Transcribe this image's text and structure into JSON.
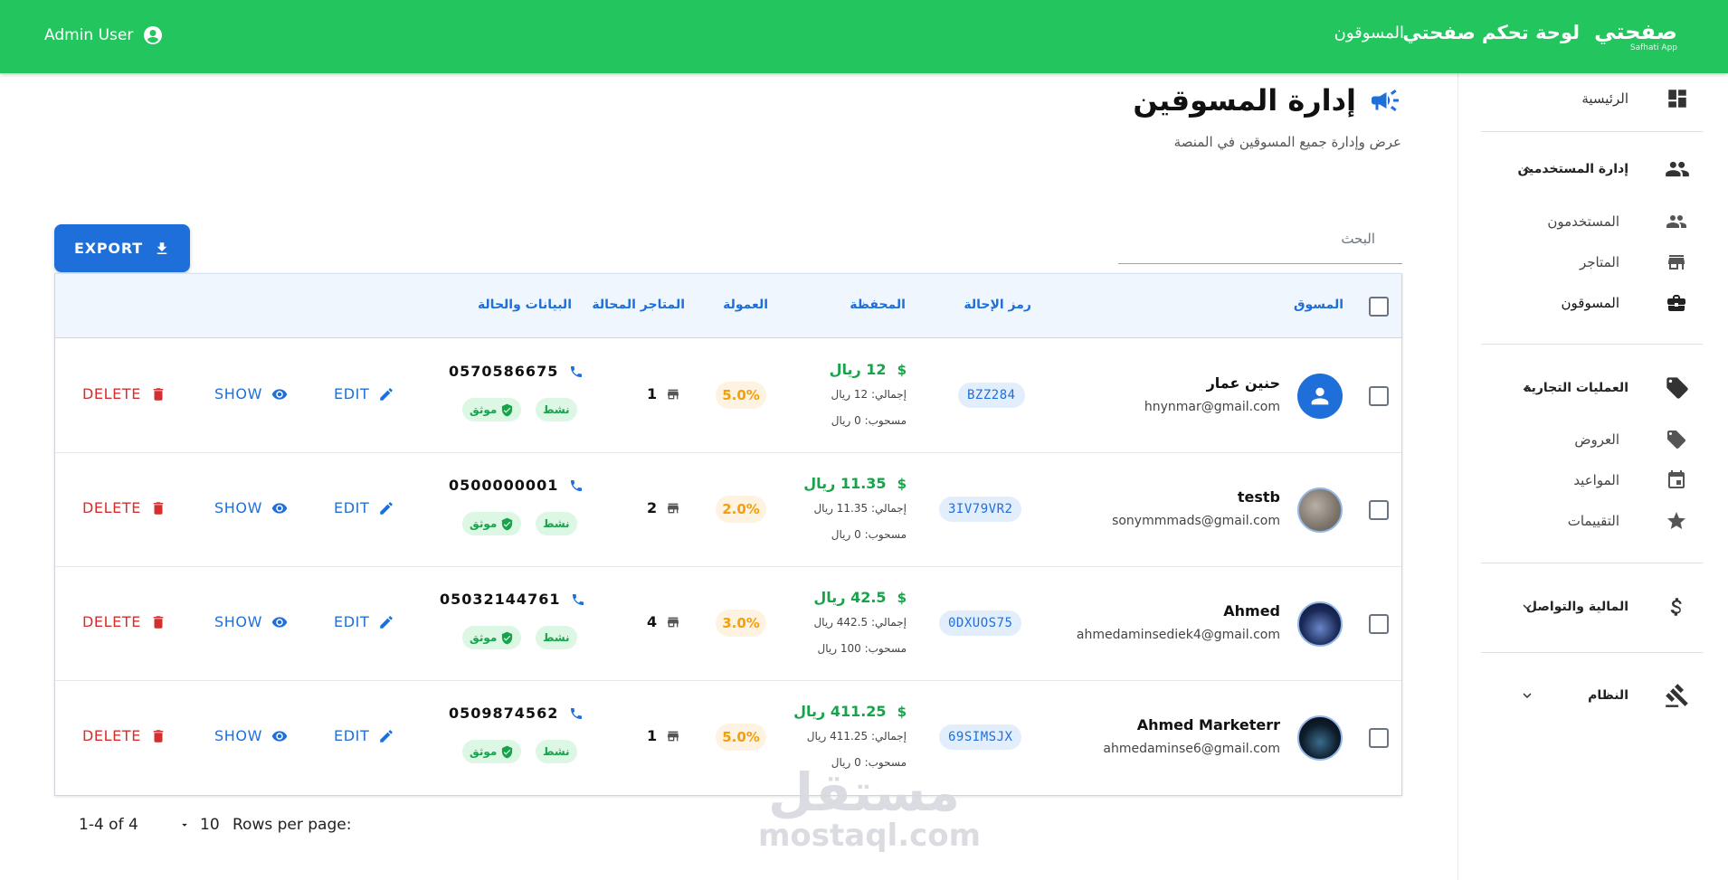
{
  "header": {
    "logo_text": "صفحتي",
    "logo_sub": "Safhati App",
    "dashboard_title": "لوحة تحكم صفحتي",
    "section_link": "المسوقون",
    "user_name": "Admin User"
  },
  "sidebar": {
    "home": "الرئيسية",
    "users_mgmt": "إدارة المستخدمين",
    "users": "المستخدمون",
    "stores": "المتاجر",
    "marketers": "المسوقون",
    "commerce": "العمليات التجارية",
    "offers": "العروض",
    "appointments": "المواعيد",
    "ratings": "التقييمات",
    "finance": "المالية والتواصل",
    "system": "النظام"
  },
  "page": {
    "title": "إدارة المسوقين",
    "subtitle": "عرض وإدارة جميع المسوقين في المنصة",
    "search_placeholder": "البحث",
    "export_label": "EXPORT"
  },
  "table": {
    "headers": {
      "marketer": "المسوق",
      "referral": "رمز الإحالة",
      "wallet": "المحفظة",
      "commission": "العمولة",
      "stores": "المتاجر المحالة",
      "status": "البيانات والحالة"
    },
    "rows": [
      {
        "name": "حنين عمار",
        "email": "hnynmar@gmail.com",
        "referral": "BZZ284",
        "wallet_amount": "12 ريال",
        "wallet_total": "إجمالي: 12 ريال",
        "wallet_withdrawn": "مسحوب: 0 ريال",
        "commission": "5.0%",
        "stores": "1",
        "phone": "0570586675",
        "status_active": "نشط",
        "status_verified": "موثق",
        "edit": "EDIT",
        "show": "SHOW",
        "delete": "DELETE"
      },
      {
        "name": "testb",
        "email": "sonymmmads@gmail.com",
        "referral": "3IV79VR2",
        "wallet_amount": "11.35 ريال",
        "wallet_total": "إجمالي: 11.35 ريال",
        "wallet_withdrawn": "مسحوب: 0 ريال",
        "commission": "2.0%",
        "stores": "2",
        "phone": "0500000001",
        "status_active": "نشط",
        "status_verified": "موثق",
        "edit": "EDIT",
        "show": "SHOW",
        "delete": "DELETE"
      },
      {
        "name": "Ahmed",
        "email": "ahmedaminsediek4@gmail.com",
        "referral": "0DXUOS75",
        "wallet_amount": "42.5 ريال",
        "wallet_total": "إجمالي: 442.5 ريال",
        "wallet_withdrawn": "مسحوب: 100 ريال",
        "commission": "3.0%",
        "stores": "4",
        "phone": "05032144761",
        "status_active": "نشط",
        "status_verified": "موثق",
        "edit": "EDIT",
        "show": "SHOW",
        "delete": "DELETE"
      },
      {
        "name": "Ahmed Marketerr",
        "email": "ahmedaminse6@gmail.com",
        "referral": "69SIMSJX",
        "wallet_amount": "411.25 ريال",
        "wallet_total": "إجمالي: 411.25 ريال",
        "wallet_withdrawn": "مسحوب: 0 ريال",
        "commission": "5.0%",
        "stores": "1",
        "phone": "0509874562",
        "status_active": "نشط",
        "status_verified": "موثق",
        "edit": "EDIT",
        "show": "SHOW",
        "delete": "DELETE"
      }
    ]
  },
  "pagination": {
    "range": "1-4 of 4",
    "rows_per_page_value": "10",
    "rows_per_page_label": "Rows per page:"
  },
  "watermark": {
    "arabic": "مستقل",
    "latin": "mostaql.com"
  },
  "colors": {
    "brand_green": "#22c55e",
    "primary_blue": "#1e6fd9",
    "danger_red": "#d32f2f",
    "money_green": "#16a34a",
    "commission_orange": "#f59e0b"
  }
}
